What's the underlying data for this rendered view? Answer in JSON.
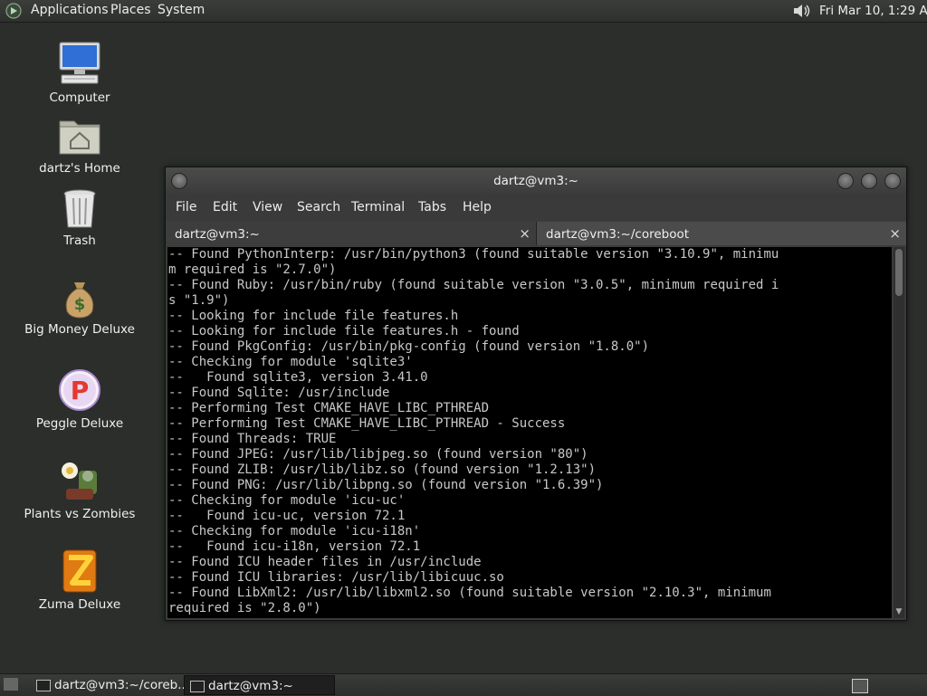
{
  "top_panel": {
    "menus": [
      "Applications",
      "Places",
      "System"
    ],
    "clock": "Fri Mar 10, 1:29 AM"
  },
  "desktop": {
    "icons": [
      {
        "label": "Computer"
      },
      {
        "label": "dartz's Home"
      },
      {
        "label": "Trash"
      },
      {
        "label": "Big Money Deluxe"
      },
      {
        "label": "Peggle Deluxe"
      },
      {
        "label": "Plants vs Zombies"
      },
      {
        "label": "Zuma Deluxe"
      }
    ]
  },
  "terminal": {
    "title": "dartz@vm3:~",
    "menu": [
      "File",
      "Edit",
      "View",
      "Search",
      "Terminal",
      "Tabs",
      "Help"
    ],
    "tabs": [
      {
        "label": "dartz@vm3:~",
        "close": "×"
      },
      {
        "label": "dartz@vm3:~/coreboot",
        "close": "×"
      }
    ],
    "lines": [
      "-- Found PythonInterp: /usr/bin/python3 (found suitable version \"3.10.9\", minimu",
      "m required is \"2.7.0\")",
      "-- Found Ruby: /usr/bin/ruby (found suitable version \"3.0.5\", minimum required i",
      "s \"1.9\")",
      "-- Looking for include file features.h",
      "-- Looking for include file features.h - found",
      "-- Found PkgConfig: /usr/bin/pkg-config (found version \"1.8.0\")",
      "-- Checking for module 'sqlite3'",
      "--   Found sqlite3, version 3.41.0",
      "-- Found Sqlite: /usr/include",
      "-- Performing Test CMAKE_HAVE_LIBC_PTHREAD",
      "-- Performing Test CMAKE_HAVE_LIBC_PTHREAD - Success",
      "-- Found Threads: TRUE",
      "-- Found JPEG: /usr/lib/libjpeg.so (found version \"80\")",
      "-- Found ZLIB: /usr/lib/libz.so (found version \"1.2.13\")",
      "-- Found PNG: /usr/lib/libpng.so (found version \"1.6.39\")",
      "-- Checking for module 'icu-uc'",
      "--   Found icu-uc, version 72.1",
      "-- Checking for module 'icu-i18n'",
      "--   Found icu-i18n, version 72.1",
      "-- Found ICU header files in /usr/include",
      "-- Found ICU libraries: /usr/lib/libicuuc.so",
      "-- Found LibXml2: /usr/lib/libxml2.so (found suitable version \"2.10.3\", minimum",
      "required is \"2.8.0\")"
    ]
  },
  "taskbar": {
    "tasks": [
      {
        "label": "dartz@vm3:~/coreb..."
      },
      {
        "label": "dartz@vm3:~"
      }
    ]
  }
}
